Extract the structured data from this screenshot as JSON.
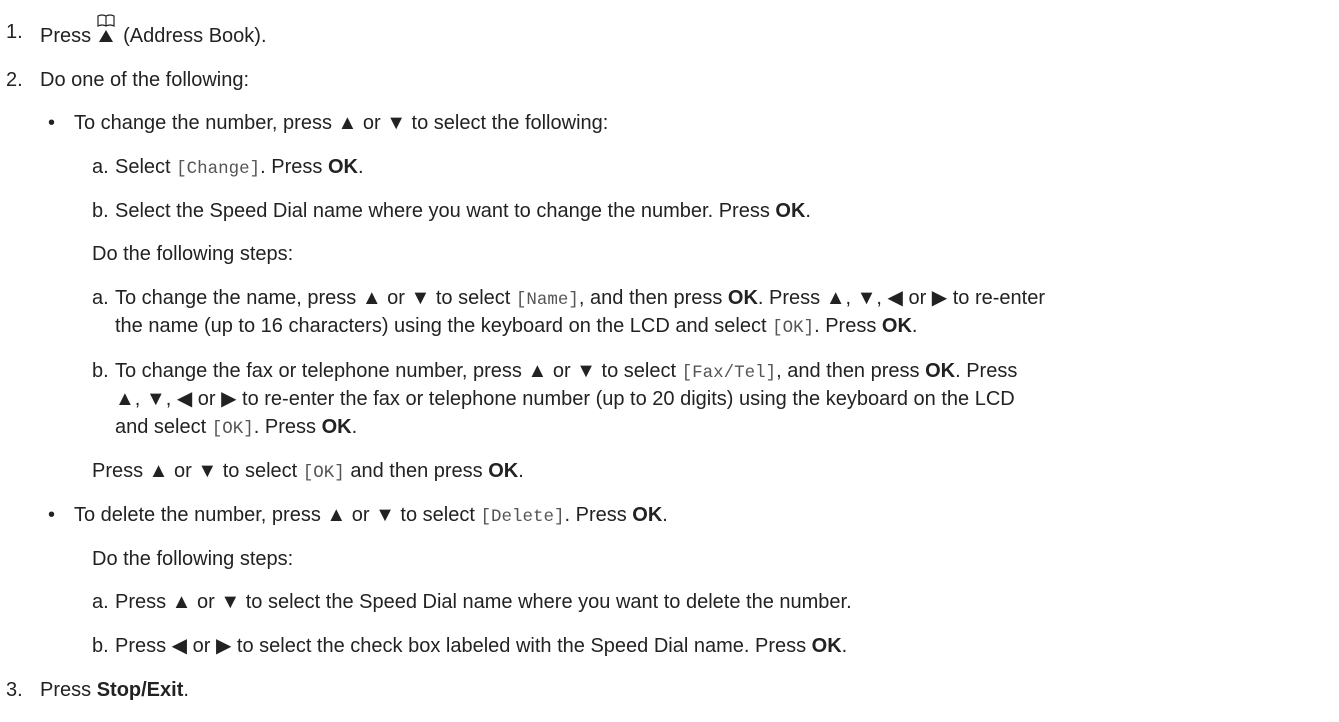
{
  "steps": {
    "s1": {
      "num": "1.",
      "pre": "Press",
      "post": "(Address Book)."
    },
    "s2": {
      "num": "2.",
      "text": "Do one of the following:",
      "bullet1": {
        "marker": "•",
        "text": "To change the number, press ▲ or ▼ to select the following:",
        "a": {
          "marker": "a.",
          "pre": "Select",
          "code": "[Change]",
          "mid": ". Press",
          "bold": "OK",
          "end": "."
        },
        "b": {
          "marker": "b.",
          "pre": "Select the Speed Dial name where you want to change the number. Press",
          "bold": "OK",
          "end": "."
        },
        "steps_label": "Do the following steps:",
        "a2": {
          "marker": "a.",
          "l1_pre": "To change the name, press ▲ or ▼ to select",
          "l1_code": "[Name]",
          "l1_mid": ", and then press",
          "l1_bold": "OK",
          "l1_end": ". Press ▲, ▼, ◀ or ▶ to re-enter",
          "l2_pre": "the name (up to 16 characters) using the keyboard on the LCD and select",
          "l2_code": "[OK]",
          "l2_mid": ". Press",
          "l2_bold": "OK",
          "l2_end": "."
        },
        "b2": {
          "marker": "b.",
          "l1_pre": "To change the fax or telephone number, press ▲ or ▼ to select",
          "l1_code": "[Fax/Tel]",
          "l1_mid": ", and then press",
          "l1_bold": "OK",
          "l1_end": ". Press",
          "l2": "▲, ▼, ◀ or ▶ to re-enter the fax or telephone number (up to 20 digits) using the keyboard on the LCD",
          "l3_pre": "and select",
          "l3_code": "[OK]",
          "l3_mid": ". Press",
          "l3_bold": "OK",
          "l3_end": "."
        },
        "final": {
          "pre": "Press ▲ or ▼ to select",
          "code": "[OK]",
          "mid": "and then press",
          "bold": "OK",
          "end": "."
        }
      },
      "bullet2": {
        "marker": "•",
        "pre": "To delete the number, press ▲ or ▼ to select",
        "code": "[Delete]",
        "mid": ". Press",
        "bold": "OK",
        "end": ".",
        "steps_label": "Do the following steps:",
        "a": {
          "marker": "a.",
          "text": "Press ▲ or ▼ to select the Speed Dial name where you want to delete the number."
        },
        "b": {
          "marker": "b.",
          "pre": "Press ◀ or ▶ to select the check box labeled with the Speed Dial name. Press",
          "bold": "OK",
          "end": "."
        }
      }
    },
    "s3": {
      "num": "3.",
      "pre": "Press",
      "bold": "Stop/Exit",
      "end": "."
    }
  },
  "icons": {
    "address_book": "address-book-icon"
  }
}
